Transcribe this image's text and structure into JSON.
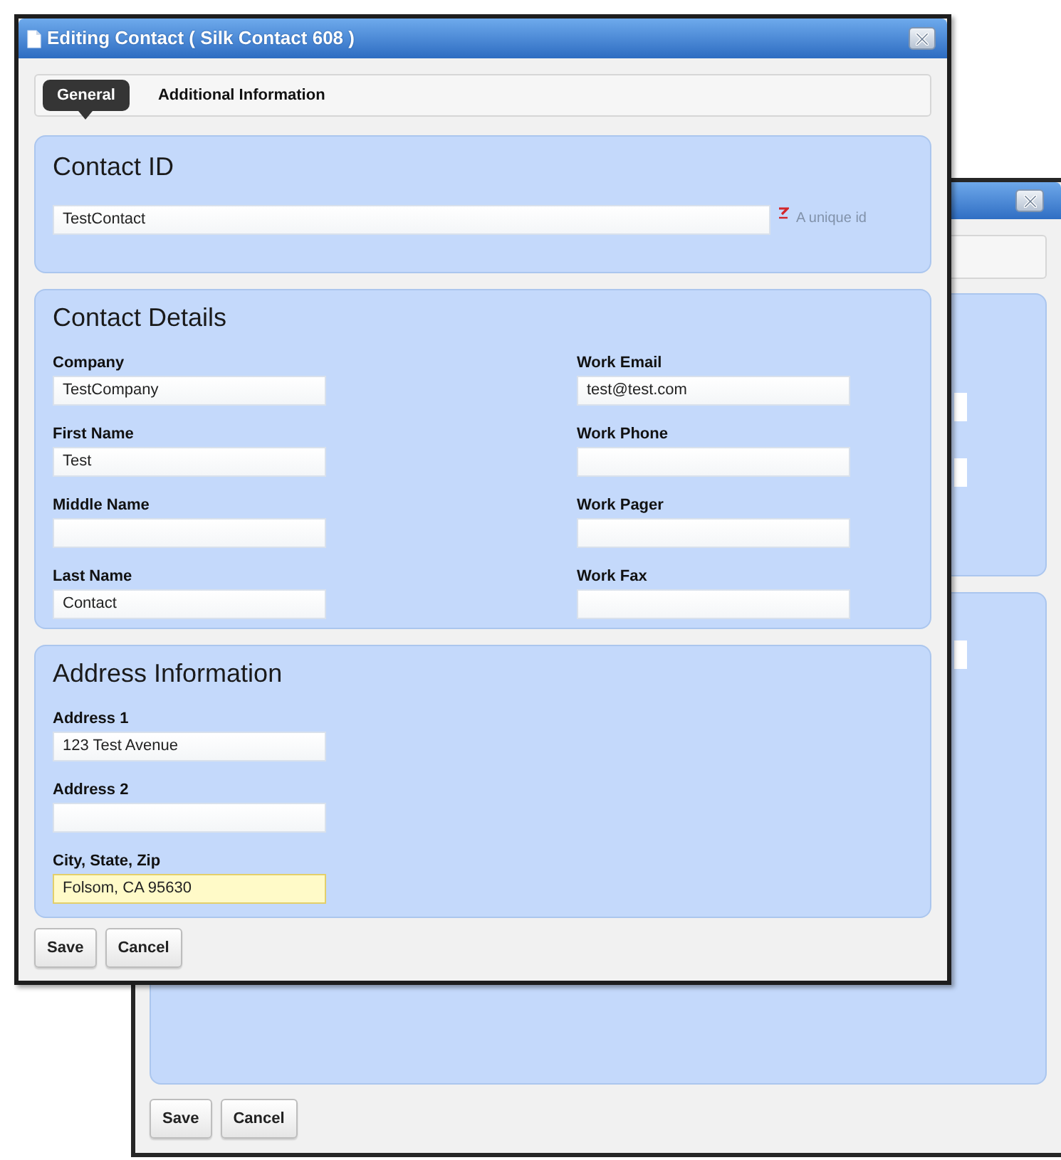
{
  "front_dialog": {
    "title": "Editing Contact ( Silk Contact 608 )",
    "tabs": [
      {
        "label": "General",
        "selected": true
      },
      {
        "label": "Additional Information",
        "selected": false
      }
    ],
    "sections": [
      {
        "heading": "Contact ID",
        "kind": "id",
        "field": {
          "value": "TestContact",
          "required": true,
          "hint": "A unique id"
        }
      },
      {
        "heading": "Contact Details",
        "kind": "columns",
        "columns": [
          [
            {
              "label": "Company",
              "value": "TestCompany",
              "highlighted": false
            },
            {
              "label": "First Name",
              "value": "Test",
              "highlighted": false
            },
            {
              "label": "Middle Name",
              "highlighted": false
            },
            {
              "label": "Last Name",
              "value": "Contact",
              "highlighted": false
            }
          ],
          [
            {
              "label": "Work Email",
              "value": "test@test.com",
              "highlighted": false
            },
            {
              "label": "Work Phone",
              "highlighted": false
            },
            {
              "label": "Work Pager",
              "highlighted": false
            },
            {
              "label": "Work Fax",
              "highlighted": false
            }
          ]
        ]
      },
      {
        "heading": "Address Information",
        "kind": "columns",
        "columns": [
          [
            {
              "label": "Address 1",
              "value": "123 Test Avenue",
              "highlighted": false
            },
            {
              "label": "Address 2",
              "highlighted": false
            },
            {
              "label": "City, State, Zip",
              "value": "Folsom, CA 95630",
              "highlighted": true
            }
          ]
        ]
      }
    ],
    "buttons": [
      "Save",
      "Cancel"
    ]
  },
  "back_dialog": {
    "buttons": [
      "Save",
      "Cancel"
    ]
  }
}
